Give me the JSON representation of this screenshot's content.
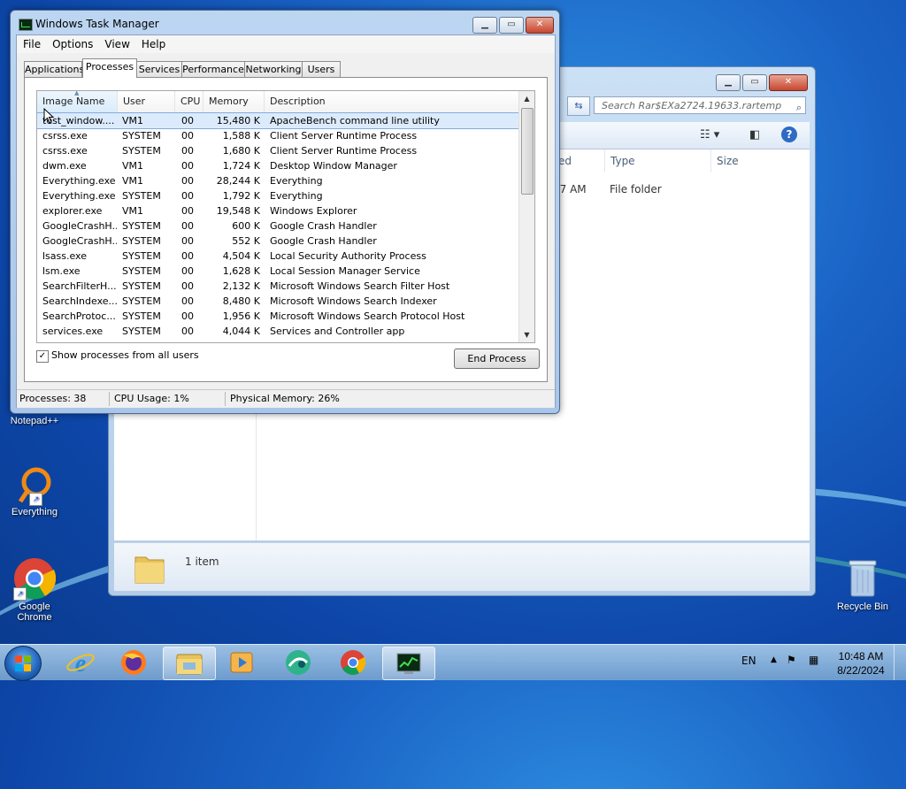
{
  "desktop": {
    "icons": [
      {
        "label": "Notepad++"
      },
      {
        "label": "Everything"
      },
      {
        "label": "Google Chrome"
      },
      {
        "label": "Recycle Bin"
      }
    ]
  },
  "explorer": {
    "search_placeholder": "Search Rar$EXa2724.19633.rartemp",
    "columns": {
      "modified_partial": "ed",
      "type": "Type",
      "size": "Size"
    },
    "row": {
      "time_partial": "47 AM",
      "type": "File folder"
    },
    "status": "1 item"
  },
  "task_manager": {
    "title": "Windows Task Manager",
    "menu": [
      "File",
      "Options",
      "View",
      "Help"
    ],
    "tabs": [
      "Applications",
      "Processes",
      "Services",
      "Performance",
      "Networking",
      "Users"
    ],
    "active_tab": "Processes",
    "columns": [
      "Image Name",
      "User Name",
      "CPU",
      "Memory (...",
      "Description"
    ],
    "processes": [
      {
        "image": "test_window....",
        "user": "VM1",
        "cpu": "00",
        "mem": "15,480 K",
        "desc": "ApacheBench command line utility",
        "selected": true
      },
      {
        "image": "csrss.exe",
        "user": "SYSTEM",
        "cpu": "00",
        "mem": "1,588 K",
        "desc": "Client Server Runtime Process"
      },
      {
        "image": "csrss.exe",
        "user": "SYSTEM",
        "cpu": "00",
        "mem": "1,680 K",
        "desc": "Client Server Runtime Process"
      },
      {
        "image": "dwm.exe",
        "user": "VM1",
        "cpu": "00",
        "mem": "1,724 K",
        "desc": "Desktop Window Manager"
      },
      {
        "image": "Everything.exe",
        "user": "VM1",
        "cpu": "00",
        "mem": "28,244 K",
        "desc": "Everything"
      },
      {
        "image": "Everything.exe",
        "user": "SYSTEM",
        "cpu": "00",
        "mem": "1,792 K",
        "desc": "Everything"
      },
      {
        "image": "explorer.exe",
        "user": "VM1",
        "cpu": "00",
        "mem": "19,548 K",
        "desc": "Windows Explorer"
      },
      {
        "image": "GoogleCrashH...",
        "user": "SYSTEM",
        "cpu": "00",
        "mem": "600 K",
        "desc": "Google Crash Handler"
      },
      {
        "image": "GoogleCrashH...",
        "user": "SYSTEM",
        "cpu": "00",
        "mem": "552 K",
        "desc": "Google Crash Handler"
      },
      {
        "image": "lsass.exe",
        "user": "SYSTEM",
        "cpu": "00",
        "mem": "4,504 K",
        "desc": "Local Security Authority Process"
      },
      {
        "image": "lsm.exe",
        "user": "SYSTEM",
        "cpu": "00",
        "mem": "1,628 K",
        "desc": "Local Session Manager Service"
      },
      {
        "image": "SearchFilterH...",
        "user": "SYSTEM",
        "cpu": "00",
        "mem": "2,132 K",
        "desc": "Microsoft Windows Search Filter Host"
      },
      {
        "image": "SearchIndexe...",
        "user": "SYSTEM",
        "cpu": "00",
        "mem": "8,480 K",
        "desc": "Microsoft Windows Search Indexer"
      },
      {
        "image": "SearchProtoc...",
        "user": "SYSTEM",
        "cpu": "00",
        "mem": "1,956 K",
        "desc": "Microsoft Windows Search Protocol Host"
      },
      {
        "image": "services.exe",
        "user": "SYSTEM",
        "cpu": "00",
        "mem": "4,044 K",
        "desc": "Services and Controller app"
      }
    ],
    "show_all_users_label": "Show processes from all users",
    "show_all_users_checked": true,
    "end_process_label": "End Process",
    "status": {
      "processes": "Processes: 38",
      "cpu": "CPU Usage: 1%",
      "memory": "Physical Memory: 26%"
    }
  },
  "taskbar": {
    "language": "EN",
    "time": "10:48 AM",
    "date": "8/22/2024",
    "pinned": [
      "internet-explorer-icon",
      "firefox-icon",
      "file-explorer-icon",
      "media-player-icon",
      "app-icon",
      "chrome-icon",
      "task-manager-icon"
    ]
  }
}
